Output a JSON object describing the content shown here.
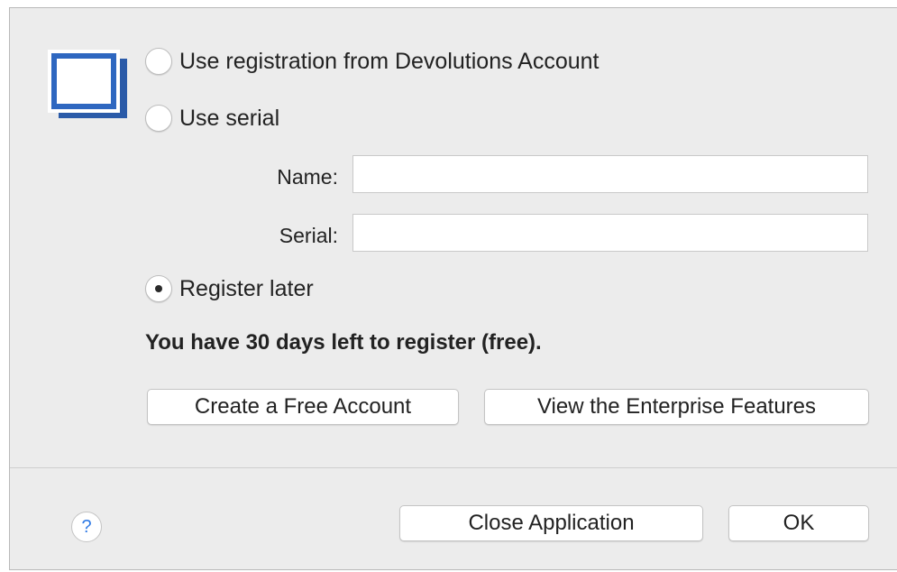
{
  "registration": {
    "option_account_label": "Use registration from Devolutions Account",
    "option_serial_label": "Use serial",
    "name_label": "Name:",
    "name_value": "",
    "serial_label": "Serial:",
    "serial_value": "",
    "option_later_label": "Register later",
    "selected_option": "Register later",
    "notice": "You have 30 days left to register (free)."
  },
  "buttons": {
    "create_account": "Create a Free Account",
    "view_enterprise": "View the Enterprise Features",
    "close_application": "Close Application",
    "ok": "OK"
  },
  "help": {
    "glyph": "?"
  },
  "icons": {
    "app_icon": "window-icon",
    "app_icon_color": "#2e67c0",
    "help_icon": "help-question-icon",
    "help_color": "#2f7ae5"
  }
}
